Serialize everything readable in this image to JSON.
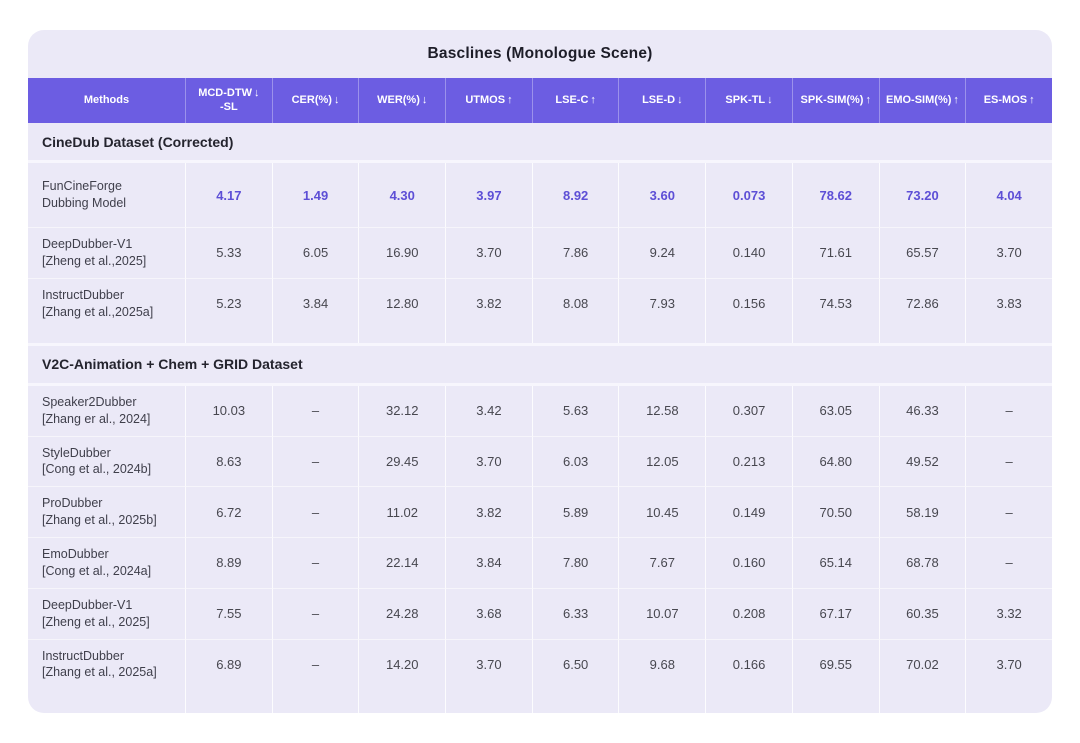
{
  "table": {
    "title": "Basclines (Monologue Scene)",
    "columns": [
      {
        "label": "Methods",
        "arrow": ""
      },
      {
        "label": "MCD-DTW",
        "label2": "-SL",
        "arrow": "↓"
      },
      {
        "label": "CER(%)",
        "arrow": "↓"
      },
      {
        "label": "WER(%)",
        "arrow": "↓"
      },
      {
        "label": "UTMOS",
        "arrow": "↑"
      },
      {
        "label": "LSE-C",
        "arrow": "↑"
      },
      {
        "label": "LSE-D",
        "arrow": "↓"
      },
      {
        "label": "SPK-TL",
        "arrow": "↓"
      },
      {
        "label": "SPK-SIM(%)",
        "arrow": "↑"
      },
      {
        "label": "EMO-SIM(%)",
        "arrow": "↑"
      },
      {
        "label": "ES-MOS",
        "arrow": "↑"
      }
    ],
    "sections": [
      {
        "heading": "CineDub Dataset (Corrected)",
        "rows": [
          {
            "method": "FunCineForge",
            "sub": "Dubbing Model",
            "highlight": true,
            "values": [
              "4.17",
              "1.49",
              "4.30",
              "3.97",
              "8.92",
              "3.60",
              "0.073",
              "78.62",
              "73.20",
              "4.04"
            ]
          },
          {
            "method": "DeepDubber-V1",
            "sub": "[Zheng et al.,2025]",
            "values": [
              "5.33",
              "6.05",
              "16.90",
              "3.70",
              "7.86",
              "9.24",
              "0.140",
              "71.61",
              "65.57",
              "3.70"
            ]
          },
          {
            "method": "InstructDubber",
            "sub": "[Zhang et al.,2025a]",
            "values": [
              "5.23",
              "3.84",
              "12.80",
              "3.82",
              "8.08",
              "7.93",
              "0.156",
              "74.53",
              "72.86",
              "3.83"
            ]
          }
        ]
      },
      {
        "heading": "V2C-Animation + Chem + GRID Dataset",
        "rows": [
          {
            "method": "Speaker2Dubber",
            "sub": "[Zhang er al., 2024]",
            "values": [
              "10.03",
              "–",
              "32.12",
              "3.42",
              "5.63",
              "12.58",
              "0.307",
              "63.05",
              "46.33",
              "–"
            ]
          },
          {
            "method": "StyleDubber",
            "sub": "[Cong et al., 2024b]",
            "values": [
              "8.63",
              "–",
              "29.45",
              "3.70",
              "6.03",
              "12.05",
              "0.213",
              "64.80",
              "49.52",
              "–"
            ]
          },
          {
            "method": "ProDubber",
            "sub": "[Zhang et al., 2025b]",
            "values": [
              "6.72",
              "–",
              "11.02",
              "3.82",
              "5.89",
              "10.45",
              "0.149",
              "70.50",
              "58.19",
              "–"
            ]
          },
          {
            "method": "EmoDubber",
            "sub": "[Cong et al., 2024a]",
            "values": [
              "8.89",
              "–",
              "22.14",
              "3.84",
              "7.80",
              "7.67",
              "0.160",
              "65.14",
              "68.78",
              "–"
            ]
          },
          {
            "method": "DeepDubber-V1",
            "sub": "[Zheng et al., 2025]",
            "values": [
              "7.55",
              "–",
              "24.28",
              "3.68",
              "6.33",
              "10.07",
              "0.208",
              "67.17",
              "60.35",
              "3.32"
            ]
          },
          {
            "method": "InstructDubber",
            "sub": "[Zhang et al., 2025a]",
            "values": [
              "6.89",
              "–",
              "14.20",
              "3.70",
              "6.50",
              "9.68",
              "0.166",
              "69.55",
              "70.02",
              "3.70"
            ]
          }
        ]
      }
    ]
  },
  "colors": {
    "accent_purple": "#6C5DE2",
    "highlight_value_purple": "#5D4FD6",
    "card_background": "#EBE9F7"
  }
}
